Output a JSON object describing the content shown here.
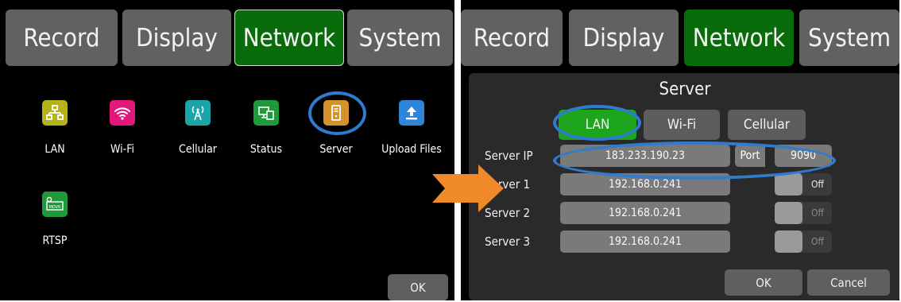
{
  "left": {
    "tabs": [
      "Record",
      "Display",
      "Network",
      "System"
    ],
    "active_tab": "Network",
    "apps": [
      {
        "label": "LAN",
        "icon": "lan-icon",
        "color": "#b6b31a"
      },
      {
        "label": "Wi-Fi",
        "icon": "wifi-icon",
        "color": "#e2187c"
      },
      {
        "label": "Cellular",
        "icon": "cellular-icon",
        "color": "#1aa6a8"
      },
      {
        "label": "Status",
        "icon": "status-icon",
        "color": "#1e9a3a"
      },
      {
        "label": "Server",
        "icon": "server-icon",
        "color": "#d4922a"
      },
      {
        "label": "Upload Files",
        "icon": "upload-icon",
        "color": "#2f86d8"
      },
      {
        "label": "RTSP",
        "icon": "rtsp-icon",
        "color": "#1e9a3a"
      }
    ],
    "ok_label": "OK"
  },
  "right": {
    "tabs": [
      "Record",
      "Display",
      "Network",
      "System"
    ],
    "active_tab": "Network",
    "dialog": {
      "title": "Server",
      "segments": [
        "LAN",
        "Wi-Fi",
        "Cellular"
      ],
      "active_segment": "LAN",
      "server_ip_label": "Server IP",
      "server_ip": "183.233.190.23",
      "port_label": "Port",
      "port": "9090",
      "servers": [
        {
          "label": "Server 1",
          "value": "192.168.0.241",
          "toggle": "Off",
          "enabled": true
        },
        {
          "label": "Server 2",
          "value": "192.168.0.241",
          "toggle": "Off",
          "enabled": false
        },
        {
          "label": "Server 3",
          "value": "192.168.0.241",
          "toggle": "Off",
          "enabled": false
        }
      ],
      "ok_label": "OK",
      "cancel_label": "Cancel"
    }
  },
  "colors": {
    "active_tab": "#0a6b0a",
    "active_segment": "#1ea51e",
    "highlight_ring": "#2f7bd0",
    "arrow": "#ee8a2a"
  }
}
